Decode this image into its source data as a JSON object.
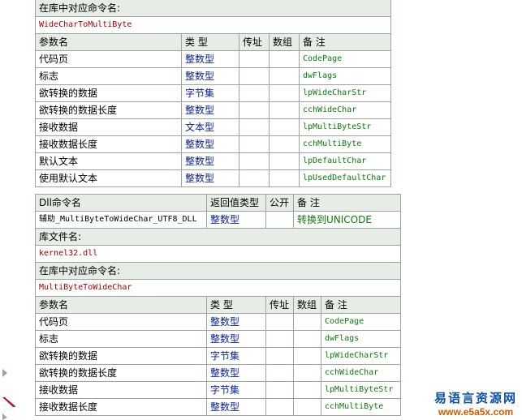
{
  "section1": {
    "lib_label": "在库中对应命令名:",
    "lib_value": "WideCharToMultiByte",
    "headers": [
      "参数名",
      "类 型",
      "传址",
      "数组",
      "备 注"
    ],
    "rows": [
      {
        "name": "代码页",
        "type": "整数型",
        "note": "CodePage"
      },
      {
        "name": "标志",
        "type": "整数型",
        "note": "dwFlags"
      },
      {
        "name": "欲转换的数据",
        "type": "字节集",
        "note": "lpWideCharStr"
      },
      {
        "name": "欲转换的数据长度",
        "type": "整数型",
        "note": "cchWideChar"
      },
      {
        "name": "接收数据",
        "type": "文本型",
        "note": "lpMultiByteStr"
      },
      {
        "name": "接收数据长度",
        "type": "整数型",
        "note": "cchMultiByte"
      },
      {
        "name": "默认文本",
        "type": "整数型",
        "note": "lpDefaultChar"
      },
      {
        "name": "使用默认文本",
        "type": "整数型",
        "note": "lpUsedDefaultChar"
      }
    ]
  },
  "section2": {
    "headers": [
      "Dll命令名",
      "返回值类型",
      "公开",
      "备 注"
    ],
    "cmd_name": "辅助_MultiByteToWideChar_UTF8_DLL",
    "cmd_type": "整数型",
    "cmd_public": "",
    "cmd_note": "转换到UNICODE",
    "file_label": "库文件名:",
    "file_value": "kernel32.dll",
    "lib_label": "在库中对应命令名:",
    "lib_value": "MultiByteToWideChar"
  },
  "section3": {
    "headers": [
      "参数名",
      "类 型",
      "传址",
      "数组",
      "备 注"
    ],
    "rows": [
      {
        "name": "代码页",
        "type": "整数型",
        "note": "CodePage"
      },
      {
        "name": "标志",
        "type": "整数型",
        "note": "dwFlags"
      },
      {
        "name": "欲转换的数据",
        "type": "字节集",
        "note": "lpWideCharStr"
      },
      {
        "name": "欲转换的数据长度",
        "type": "整数型",
        "note": "cchWideChar"
      },
      {
        "name": "接收数据",
        "type": "字节集",
        "note": "lpMultiByteStr"
      },
      {
        "name": "接收数据长度",
        "type": "整数型",
        "note": "cchMultiByte"
      }
    ]
  },
  "watermark": {
    "cn": "易语言资源网",
    "en": "www.e5a5x.com"
  }
}
